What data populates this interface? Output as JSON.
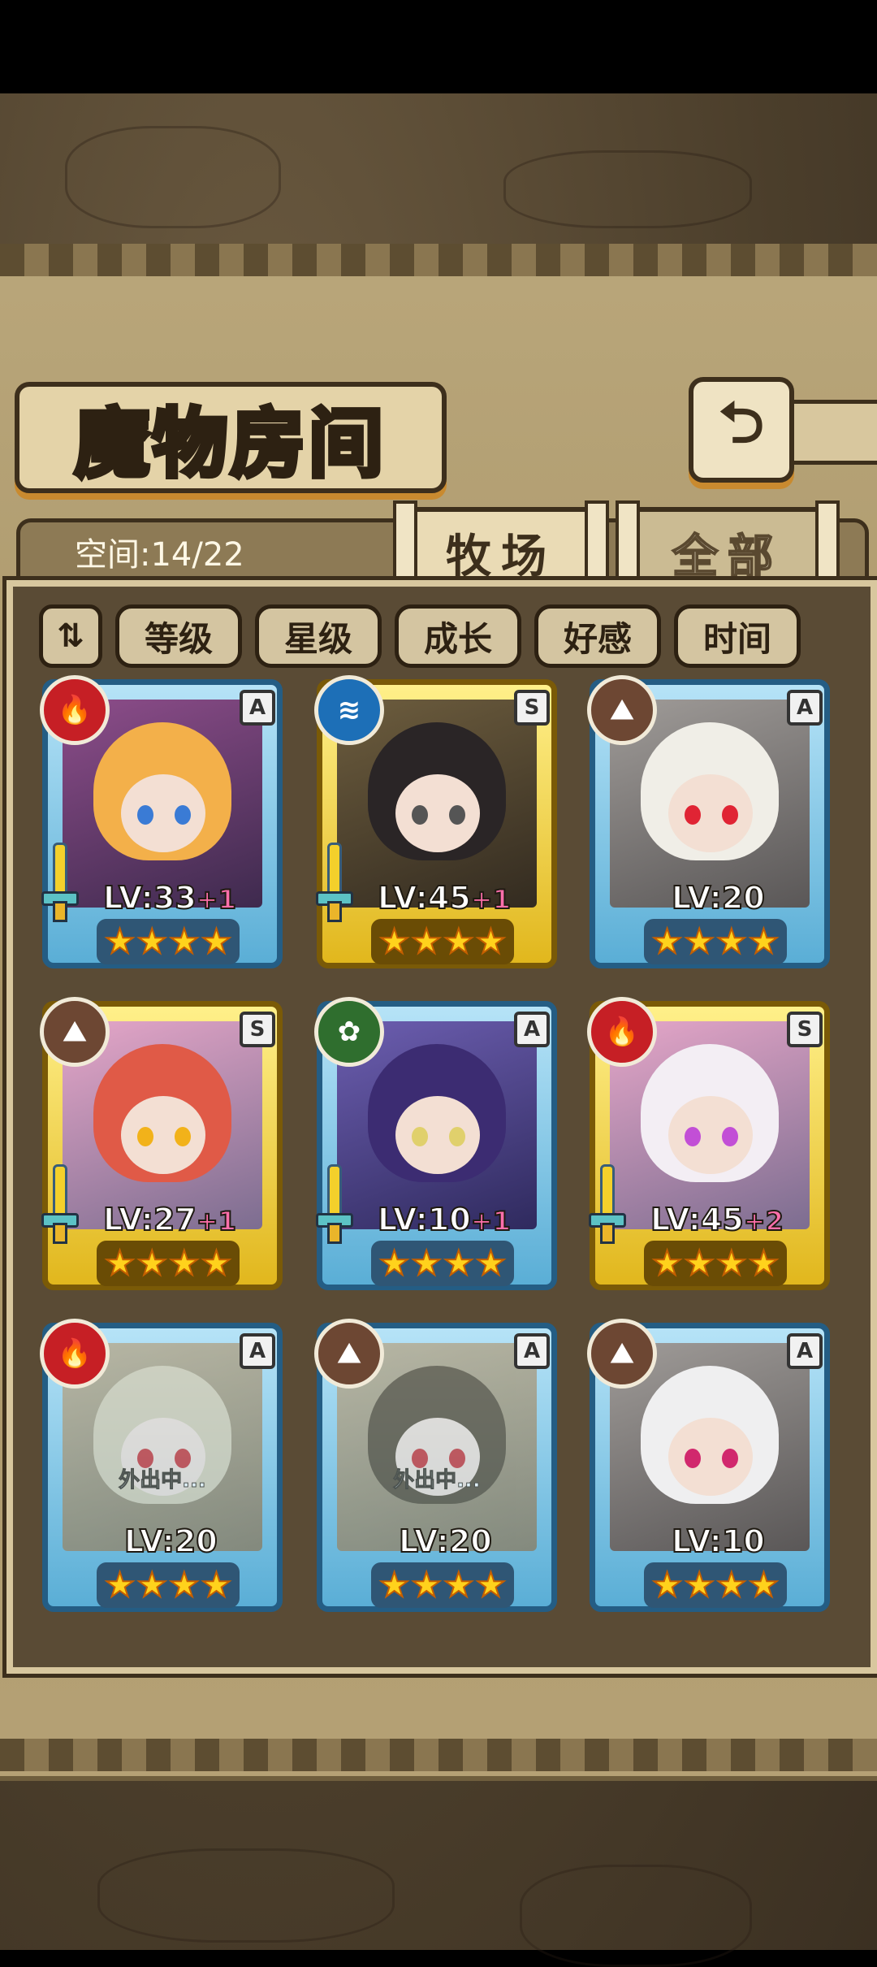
{
  "title": "魔物房间",
  "space": "空间:14/22",
  "tabs": {
    "ranch": "牧场",
    "all": "全部"
  },
  "filters": {
    "sort_icon": "sort-icon",
    "items": [
      "等级",
      "星级",
      "成长",
      "好感",
      "时间"
    ]
  },
  "back_icon": "back-arrow-icon",
  "cards": [
    {
      "element": "fire",
      "rank": "A",
      "level": "LV:33",
      "plus": "+1",
      "stars": 4,
      "weapon": true,
      "away": ""
    },
    {
      "element": "water",
      "rank": "S",
      "level": "LV:45",
      "plus": "+1",
      "stars": 4,
      "weapon": true,
      "away": ""
    },
    {
      "element": "earth",
      "rank": "A",
      "level": "LV:20",
      "plus": "",
      "stars": 4,
      "weapon": false,
      "away": ""
    },
    {
      "element": "earth",
      "rank": "S",
      "level": "LV:27",
      "plus": "+1",
      "stars": 4,
      "weapon": true,
      "away": ""
    },
    {
      "element": "nature",
      "rank": "A",
      "level": "LV:10",
      "plus": "+1",
      "stars": 4,
      "weapon": true,
      "away": ""
    },
    {
      "element": "fire",
      "rank": "S",
      "level": "LV:45",
      "plus": "+2",
      "stars": 4,
      "weapon": true,
      "away": ""
    },
    {
      "element": "fire",
      "rank": "A",
      "level": "LV:20",
      "plus": "",
      "stars": 4,
      "weapon": false,
      "away": "外出中..."
    },
    {
      "element": "earth",
      "rank": "A",
      "level": "LV:20",
      "plus": "",
      "stars": 4,
      "weapon": false,
      "away": "外出中..."
    },
    {
      "element": "earth",
      "rank": "A",
      "level": "LV:10",
      "plus": "",
      "stars": 4,
      "weapon": false,
      "away": ""
    }
  ]
}
